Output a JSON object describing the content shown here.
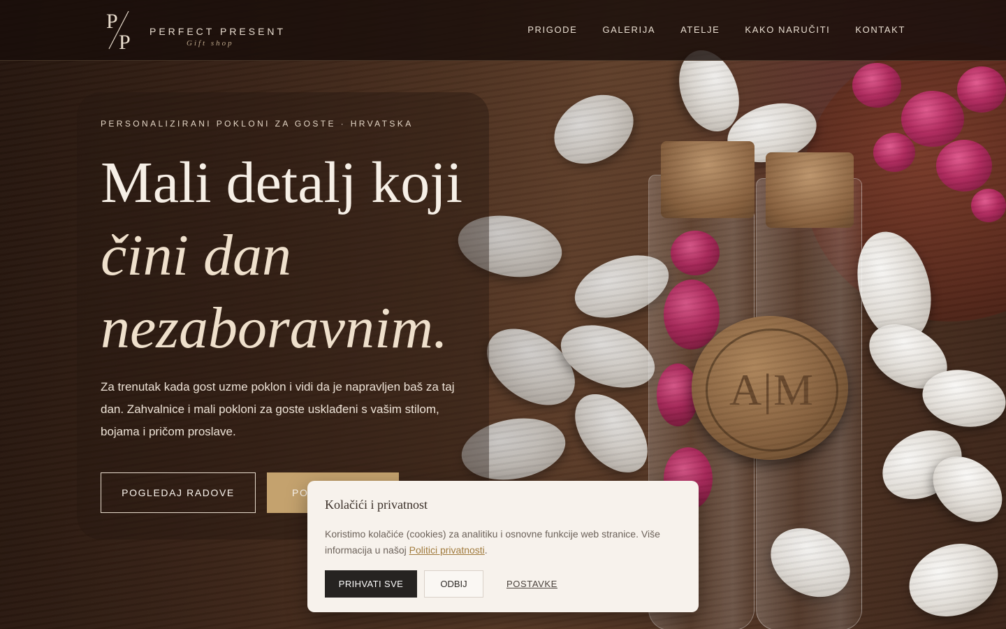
{
  "brand": {
    "initials_top": "P",
    "initials_bottom": "P",
    "name": "PERFECT PRESENT",
    "tagline": "Gift shop"
  },
  "nav": {
    "items": [
      {
        "label": "PRIGODE"
      },
      {
        "label": "GALERIJA"
      },
      {
        "label": "ATELJE"
      },
      {
        "label": "KAKO NARUČITI"
      },
      {
        "label": "KONTAKT"
      }
    ]
  },
  "hero": {
    "eyebrow": "PERSONALIZIRANI POKLONI ZA GOSTE · HRVATSKA",
    "heading_line1": "Mali detalj koji",
    "heading_line2": "čini dan",
    "heading_line3": "nezaboravnim.",
    "lead": "Za trenutak kada gost uzme poklon i vidi da je napravljen baš za taj dan. Zahvalnice i mali pokloni za goste usklađeni s vašim stilom, bojama i pričom proslave.",
    "primary_button": "POGLEDAJ RADOVE",
    "secondary_button_visible": "PO"
  },
  "photo": {
    "seal_monogram": "A|M"
  },
  "cookie": {
    "title": "Kolačići i privatnost",
    "text_before_link": "Koristimo kolačiće (cookies) za analitiku i osnovne funkcije web stranice. Više informacija u našoj ",
    "link_text": "Politici privatnosti",
    "text_after_link": ".",
    "accept_button": "PRIHVATI SVE",
    "reject_button": "ODBIJ",
    "settings_link": "POSTAVKE"
  },
  "colors": {
    "accent_gold": "#c4a26e",
    "dark_button": "#262321",
    "dialog_bg": "#f7f2ec"
  }
}
